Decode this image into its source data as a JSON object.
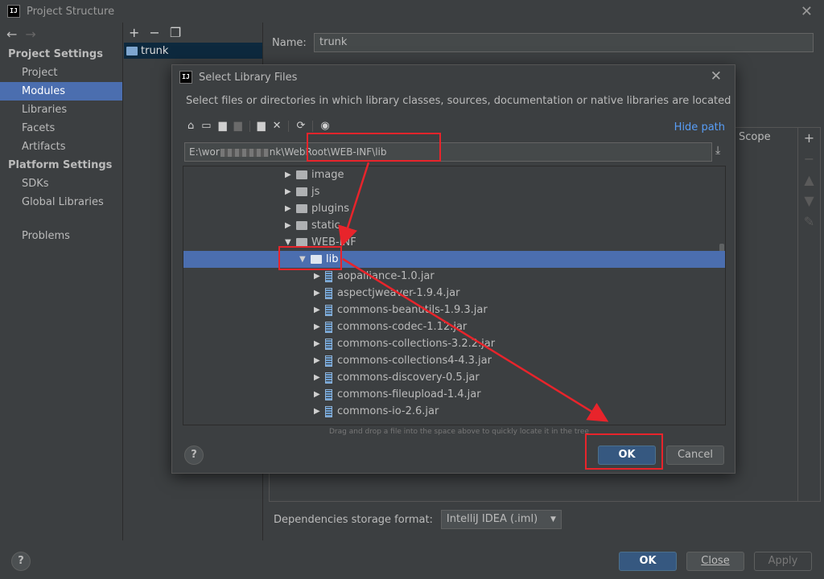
{
  "window": {
    "title": "Project Structure"
  },
  "sidebar": {
    "sections": [
      {
        "header": "Project Settings",
        "items": [
          "Project",
          "Modules",
          "Libraries",
          "Facets",
          "Artifacts"
        ]
      },
      {
        "header": "Platform Settings",
        "items": [
          "SDKs",
          "Global Libraries"
        ]
      }
    ],
    "problems": "Problems",
    "selected": "Modules"
  },
  "modules": {
    "items": [
      "trunk"
    ]
  },
  "main": {
    "name_label": "Name:",
    "name_value": "trunk",
    "scope_header": "Scope",
    "storage_label": "Dependencies storage format:",
    "storage_value": "IntelliJ IDEA (.iml)"
  },
  "footer": {
    "ok": "OK",
    "close": "Close",
    "apply": "Apply",
    "help": "?"
  },
  "dialog": {
    "title": "Select Library Files",
    "description": "Select files or directories in which library classes, sources, documentation or native libraries are located",
    "hide_path": "Hide path",
    "path_prefix": "E:\\wor",
    "path_suffix": "nk\\WebRoot\\WEB-INF\\lib",
    "tree": [
      {
        "label": "image",
        "type": "folder",
        "expanded": false,
        "indent": 1
      },
      {
        "label": "js",
        "type": "folder",
        "expanded": false,
        "indent": 1
      },
      {
        "label": "plugins",
        "type": "folder",
        "expanded": false,
        "indent": 1
      },
      {
        "label": "static",
        "type": "folder",
        "expanded": false,
        "indent": 1
      },
      {
        "label": "WEB-INF",
        "type": "folder",
        "expanded": true,
        "indent": 1
      },
      {
        "label": "lib",
        "type": "folder",
        "expanded": true,
        "indent": 2,
        "selected": true
      },
      {
        "label": "aopalliance-1.0.jar",
        "type": "jar",
        "indent": 3
      },
      {
        "label": "aspectjweaver-1.9.4.jar",
        "type": "jar",
        "indent": 3
      },
      {
        "label": "commons-beanutils-1.9.3.jar",
        "type": "jar",
        "indent": 3
      },
      {
        "label": "commons-codec-1.12.jar",
        "type": "jar",
        "indent": 3
      },
      {
        "label": "commons-collections-3.2.2.jar",
        "type": "jar",
        "indent": 3
      },
      {
        "label": "commons-collections4-4.3.jar",
        "type": "jar",
        "indent": 3
      },
      {
        "label": "commons-discovery-0.5.jar",
        "type": "jar",
        "indent": 3
      },
      {
        "label": "commons-fileupload-1.4.jar",
        "type": "jar",
        "indent": 3
      },
      {
        "label": "commons-io-2.6.jar",
        "type": "jar",
        "indent": 3
      }
    ],
    "drag_hint": "Drag and drop a file into the space above to quickly locate it in the tree",
    "ok": "OK",
    "cancel": "Cancel",
    "help": "?"
  },
  "colors": {
    "accent": "#4b6eaf",
    "annotation": "#e8242b",
    "link": "#589df6"
  }
}
